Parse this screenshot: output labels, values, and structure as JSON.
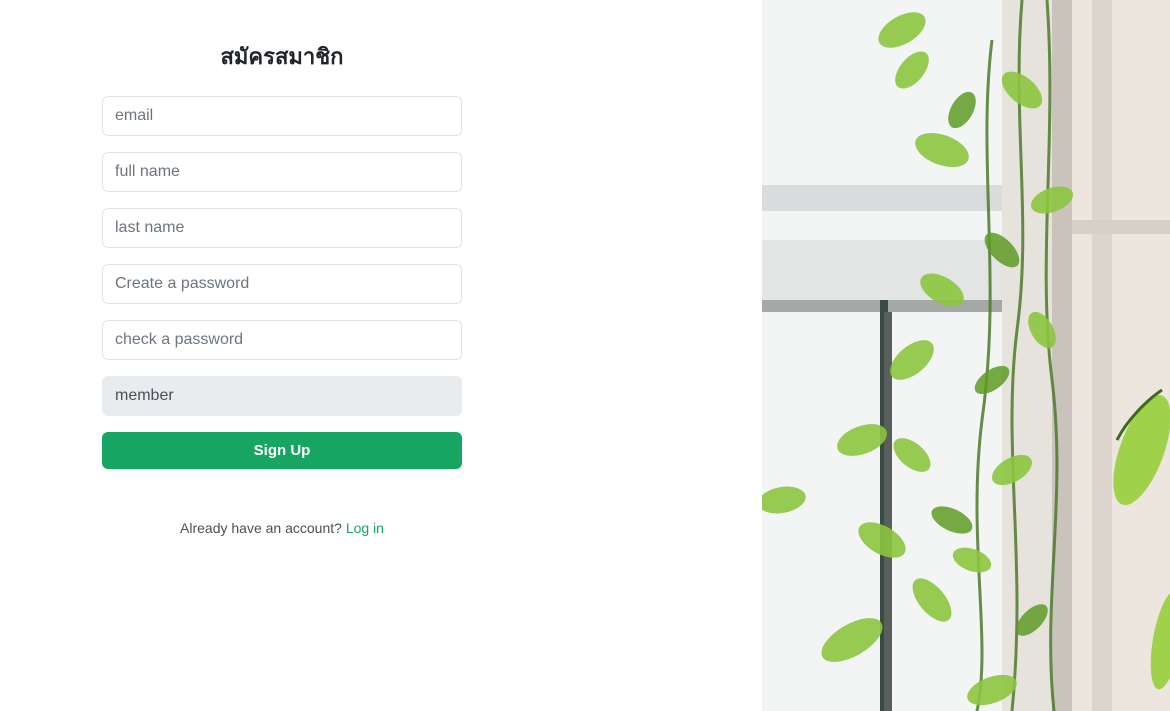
{
  "form": {
    "title": "สมัครสมาชิก",
    "email_placeholder": "email",
    "full_name_placeholder": "full name",
    "last_name_placeholder": "last name",
    "password_placeholder": "Create a password",
    "confirm_password_placeholder": "check a password",
    "role_value": "member",
    "signup_label": "Sign Up",
    "login_prompt": "Already have an account?",
    "login_link": "Log in"
  },
  "colors": {
    "accent": "#17a563",
    "readonly_bg": "#e9ecef",
    "border": "#dee2e6"
  },
  "photo": {
    "icon": "plant-photo"
  }
}
